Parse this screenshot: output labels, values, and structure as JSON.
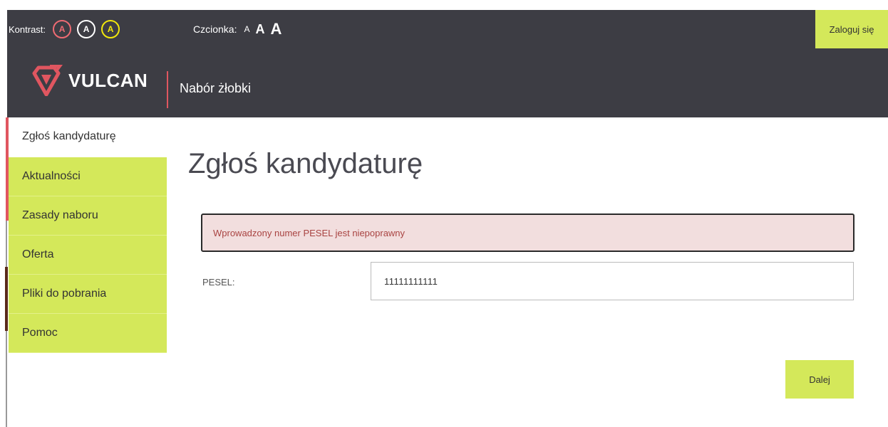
{
  "topbar": {
    "contrast_label": "Kontrast:",
    "contrast_options": [
      "A",
      "A",
      "A"
    ],
    "contrast_colors": [
      "#ef6b73",
      "#ffffff",
      "#f2e70b"
    ],
    "font_label": "Czcionka:",
    "font_options": [
      "A",
      "A",
      "A"
    ],
    "login_label": "Zaloguj się"
  },
  "header": {
    "logo_text": "VULCAN",
    "app_name": "Nabór żłobki"
  },
  "sidebar": {
    "items": [
      {
        "label": "Zgłoś kandydaturę",
        "active": true
      },
      {
        "label": "Aktualności"
      },
      {
        "label": "Zasady naboru"
      },
      {
        "label": "Oferta"
      },
      {
        "label": "Pliki do pobrania"
      },
      {
        "label": "Pomoc"
      }
    ]
  },
  "main": {
    "title": "Zgłoś kandydaturę",
    "alert_text": "Wprowadzony numer PESEL jest niepoprawny",
    "pesel_label": "PESEL:",
    "pesel_value": "11111111111",
    "next_label": "Dalej"
  },
  "colors": {
    "accent": "#d4e85a",
    "dark": "#3d3d44",
    "brand_red": "#e05660",
    "alert_bg": "#f2dede",
    "alert_text": "#a94442"
  }
}
